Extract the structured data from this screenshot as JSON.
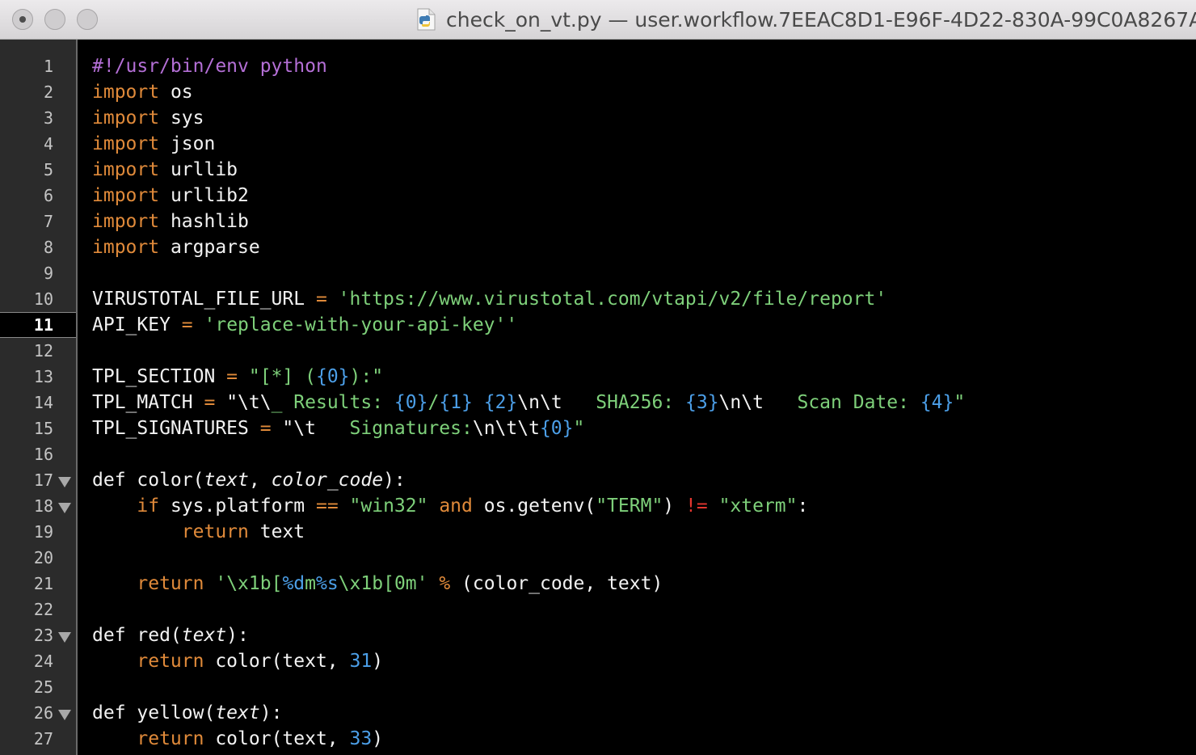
{
  "window": {
    "title": "check_on_vt.py — user.workflow.7EEAC8D1-E96F-4D22-830A-99C0A8267A",
    "file_icon": "python-file-icon"
  },
  "gutter": {
    "current_line": 11,
    "fold_lines": [
      17,
      18,
      23,
      26
    ],
    "lines": [
      "1",
      "2",
      "3",
      "4",
      "5",
      "6",
      "7",
      "8",
      "9",
      "10",
      "11",
      "12",
      "13",
      "14",
      "15",
      "16",
      "17",
      "18",
      "19",
      "20",
      "21",
      "22",
      "23",
      "24",
      "25",
      "26",
      "27"
    ]
  },
  "colors": {
    "background": "#000000",
    "gutter": "#2b2b2b",
    "keyword": "#e08a3a",
    "string": "#7ed07a",
    "format_placeholder": "#4c9fe8",
    "shebang": "#b46fd6",
    "not_equal_operator": "#e3362f",
    "text": "#f2f2f2"
  },
  "code": [
    [
      [
        "shebang",
        "#!/usr/bin/env python"
      ]
    ],
    [
      [
        "kw",
        "import"
      ],
      [
        "plain",
        " os"
      ]
    ],
    [
      [
        "kw",
        "import"
      ],
      [
        "plain",
        " sys"
      ]
    ],
    [
      [
        "kw",
        "import"
      ],
      [
        "plain",
        " json"
      ]
    ],
    [
      [
        "kw",
        "import"
      ],
      [
        "plain",
        " urllib"
      ]
    ],
    [
      [
        "kw",
        "import"
      ],
      [
        "plain",
        " urllib2"
      ]
    ],
    [
      [
        "kw",
        "import"
      ],
      [
        "plain",
        " hashlib"
      ]
    ],
    [
      [
        "kw",
        "import"
      ],
      [
        "plain",
        " argparse"
      ]
    ],
    [],
    [
      [
        "plain",
        "VIRUSTOTAL_FILE_URL "
      ],
      [
        "op",
        "="
      ],
      [
        "plain",
        " "
      ],
      [
        "str",
        "'https://www.virustotal.com/vtapi/v2/file/report'"
      ]
    ],
    [
      [
        "plain",
        "API_KEY "
      ],
      [
        "op",
        "="
      ],
      [
        "plain",
        " "
      ],
      [
        "str",
        "'replace-with-your-api-key''"
      ]
    ],
    [],
    [
      [
        "plain",
        "TPL_SECTION "
      ],
      [
        "op",
        "="
      ],
      [
        "plain",
        " "
      ],
      [
        "str",
        "\"[*] ("
      ],
      [
        "fmt",
        "{0}"
      ],
      [
        "str",
        "):\""
      ]
    ],
    [
      [
        "plain",
        "TPL_MATCH "
      ],
      [
        "op",
        "="
      ],
      [
        "plain",
        " "
      ],
      [
        "plain",
        "\"\\t\\"
      ],
      [
        "str",
        "_ Results: "
      ],
      [
        "fmt",
        "{0}"
      ],
      [
        "str",
        "/"
      ],
      [
        "fmt",
        "{1}"
      ],
      [
        "plain",
        " "
      ],
      [
        "fmt",
        "{2}"
      ],
      [
        "plain",
        "\\n\\t   "
      ],
      [
        "str",
        "SHA256: "
      ],
      [
        "fmt",
        "{3}"
      ],
      [
        "plain",
        "\\n\\t   "
      ],
      [
        "str",
        "Scan Date: "
      ],
      [
        "fmt",
        "{4}"
      ],
      [
        "str",
        "\""
      ]
    ],
    [
      [
        "plain",
        "TPL_SIGNATURES "
      ],
      [
        "op",
        "="
      ],
      [
        "plain",
        " \"\\t   "
      ],
      [
        "str",
        "Signatures:"
      ],
      [
        "plain",
        "\\n\\t\\t"
      ],
      [
        "fmt",
        "{0}"
      ],
      [
        "str",
        "\""
      ]
    ],
    [],
    [
      [
        "plain",
        "def color("
      ],
      [
        "param",
        "text"
      ],
      [
        "plain",
        ", "
      ],
      [
        "param",
        "color_code"
      ],
      [
        "plain",
        "):"
      ]
    ],
    [
      [
        "plain",
        "    "
      ],
      [
        "kw",
        "if"
      ],
      [
        "plain",
        " sys.platform "
      ],
      [
        "op",
        "=="
      ],
      [
        "plain",
        " "
      ],
      [
        "str",
        "\"win32\""
      ],
      [
        "plain",
        " "
      ],
      [
        "kw",
        "and"
      ],
      [
        "plain",
        " os.getenv("
      ],
      [
        "str",
        "\"TERM\""
      ],
      [
        "plain",
        ") "
      ],
      [
        "opred",
        "!="
      ],
      [
        "plain",
        " "
      ],
      [
        "str",
        "\"xterm\""
      ],
      [
        "plain",
        ":"
      ]
    ],
    [
      [
        "plain",
        "        "
      ],
      [
        "kw",
        "return"
      ],
      [
        "plain",
        " text"
      ]
    ],
    [],
    [
      [
        "plain",
        "    "
      ],
      [
        "kw",
        "return"
      ],
      [
        "plain",
        " "
      ],
      [
        "str",
        "'\\x1b["
      ],
      [
        "fmt",
        "%d"
      ],
      [
        "str",
        "m"
      ],
      [
        "fmt",
        "%s"
      ],
      [
        "str",
        "\\x1b[0m'"
      ],
      [
        "plain",
        " "
      ],
      [
        "op",
        "%"
      ],
      [
        "plain",
        " (color_code, text)"
      ]
    ],
    [],
    [
      [
        "plain",
        "def red("
      ],
      [
        "param",
        "text"
      ],
      [
        "plain",
        "):"
      ]
    ],
    [
      [
        "plain",
        "    "
      ],
      [
        "kw",
        "return"
      ],
      [
        "plain",
        " color(text, "
      ],
      [
        "num",
        "31"
      ],
      [
        "plain",
        ")"
      ]
    ],
    [],
    [
      [
        "plain",
        "def yellow("
      ],
      [
        "param",
        "text"
      ],
      [
        "plain",
        "):"
      ]
    ],
    [
      [
        "plain",
        "    "
      ],
      [
        "kw",
        "return"
      ],
      [
        "plain",
        " color(text, "
      ],
      [
        "num",
        "33"
      ],
      [
        "plain",
        ")"
      ]
    ]
  ]
}
